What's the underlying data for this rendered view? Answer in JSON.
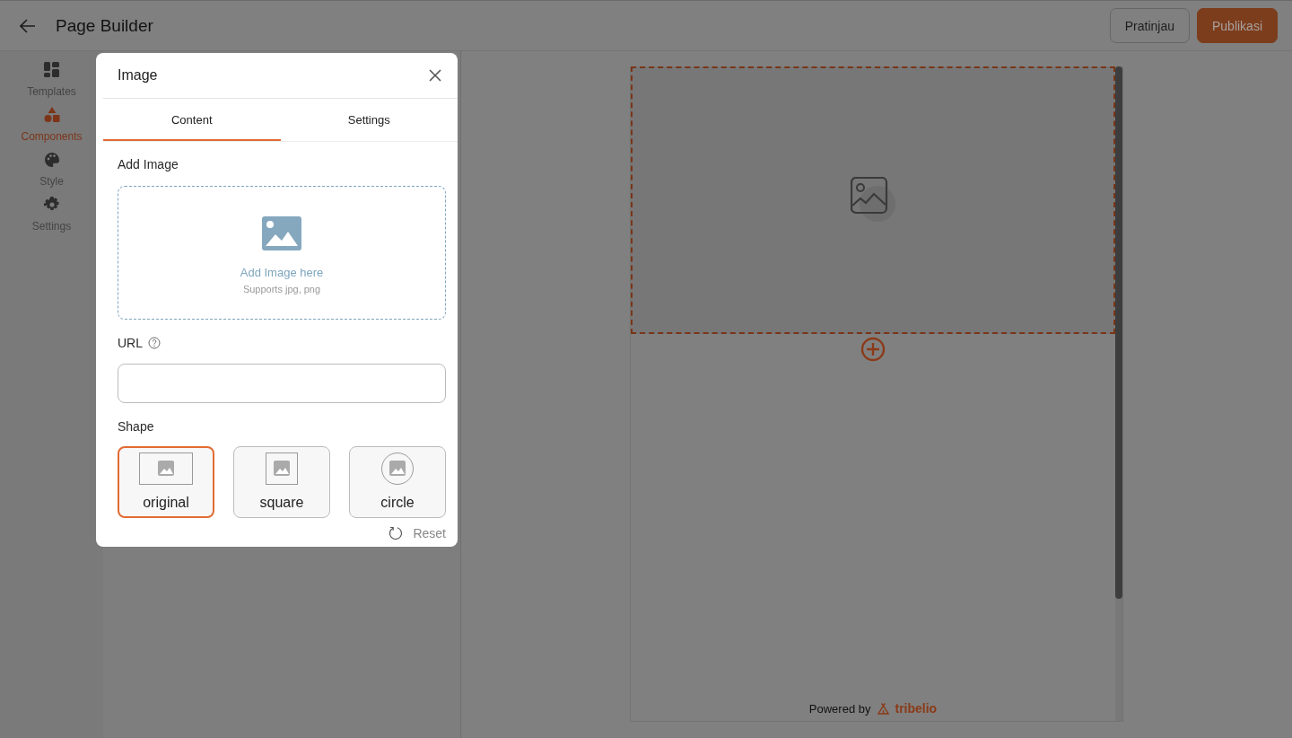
{
  "header": {
    "title": "Page Builder",
    "buttons": [
      {
        "label": "Pratinjau",
        "kind": "outline"
      },
      {
        "label": "Publikasi",
        "kind": "primary"
      }
    ]
  },
  "sidebar": {
    "items": [
      {
        "label": "Templates",
        "selected": false
      },
      {
        "label": "Components",
        "selected": true
      },
      {
        "label": "Style",
        "selected": false
      },
      {
        "label": "Settings",
        "selected": false
      }
    ]
  },
  "dialog": {
    "title": "Image",
    "tabs": [
      {
        "label": "Content",
        "selected": true
      },
      {
        "label": "Settings",
        "selected": false
      }
    ],
    "add_image": {
      "label": "Add Image",
      "prompt": "Add Image here",
      "hint": "Supports jpg, png"
    },
    "url": {
      "label": "URL"
    },
    "shape": {
      "label": "Shape",
      "options": [
        {
          "label": "original",
          "kind": "original",
          "selected": true
        },
        {
          "label": "square",
          "kind": "square",
          "selected": false
        },
        {
          "label": "circle",
          "kind": "circle",
          "selected": false
        }
      ]
    },
    "reset": "Reset"
  },
  "canvas": {
    "footer": {
      "prefix": "Powered by",
      "brand": "tribelio"
    }
  }
}
